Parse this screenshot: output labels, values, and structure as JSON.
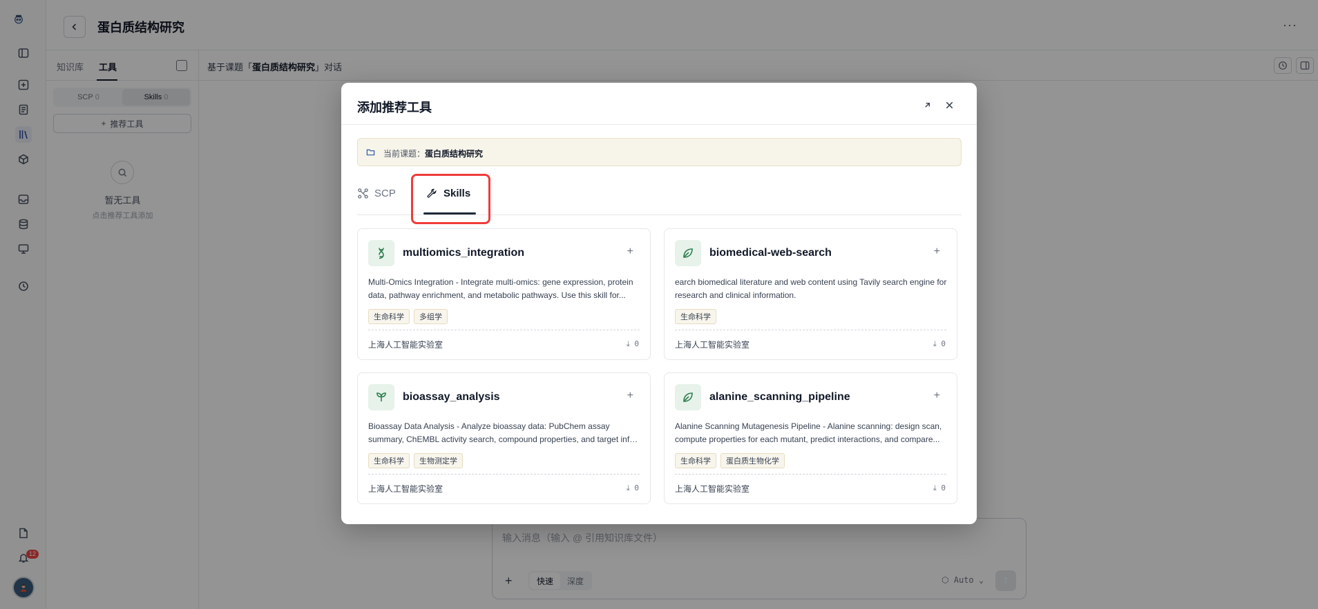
{
  "header": {
    "title": "蛋白质结构研究",
    "more_label": "···"
  },
  "panel": {
    "tabs": [
      "知识库",
      "工具"
    ],
    "segments": [
      {
        "label": "SCP",
        "count": "0"
      },
      {
        "label": "Skills",
        "count": "0"
      }
    ],
    "recommend_btn": "推荐工具",
    "empty_title": "暂无工具",
    "empty_sub": "点击推荐工具添加"
  },
  "chat": {
    "title_prefix": "基于课题「",
    "title_topic": "蛋白质结构研究",
    "title_suffix": "」对话",
    "input_placeholder": "输入消息（输入 @ 引用知识库文件）",
    "modes": [
      "快速",
      "深度"
    ],
    "model": "Auto"
  },
  "notifications": {
    "count": "12"
  },
  "modal": {
    "title": "添加推荐工具",
    "topic_label": "当前课题：",
    "topic_value": "蛋白质结构研究",
    "tabs": [
      {
        "label": "SCP",
        "icon": "network-icon"
      },
      {
        "label": "Skills",
        "icon": "wrench-icon"
      }
    ],
    "active_tab": "Skills",
    "cards": [
      {
        "title": "multiomics_integration",
        "icon": "dna-icon",
        "desc": "Multi-Omics Integration - Integrate multi-omics: gene expression, protein data, pathway enrichment, and metabolic pathways. Use this skill for...",
        "tags": [
          "生命科学",
          "多组学"
        ],
        "org": "上海人工智能实验室",
        "downloads": "0"
      },
      {
        "title": "biomedical-web-search",
        "icon": "leaf-icon",
        "desc": "earch biomedical literature and web content using Tavily search engine for research and clinical information.",
        "tags": [
          "生命科学"
        ],
        "org": "上海人工智能实验室",
        "downloads": "0"
      },
      {
        "title": "bioassay_analysis",
        "icon": "sprout-icon",
        "desc": "Bioassay Data Analysis - Analyze bioassay data: PubChem assay summary, ChEMBL activity search, compound properties, and target info. Use this...",
        "tags": [
          "生命科学",
          "生物测定学"
        ],
        "org": "上海人工智能实验室",
        "downloads": "0"
      },
      {
        "title": "alanine_scanning_pipeline",
        "icon": "leaf-icon",
        "desc": "Alanine Scanning Mutagenesis Pipeline - Alanine scanning: design scan, compute properties for each mutant, predict interactions, and compare...",
        "tags": [
          "生命科学",
          "蛋白质生物化学"
        ],
        "org": "上海人工智能实验室",
        "downloads": "0"
      }
    ]
  },
  "colors": {
    "accent_green": "#2e7d4f",
    "highlight_red": "#ef3b3b",
    "topic_bg": "#f7f4ea"
  }
}
